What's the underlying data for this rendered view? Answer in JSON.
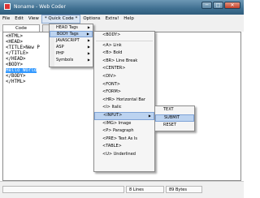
{
  "window": {
    "title": "Noname - Web Coder",
    "min": "─",
    "max": "□",
    "close": "✕"
  },
  "menubar": [
    "File",
    "Edit",
    "View",
    "* Quick Code *",
    "Options",
    "Extra!",
    "Help"
  ],
  "tabs": [
    "Code",
    ""
  ],
  "code_lines": [
    "<HTML>",
    "<HEAD>",
    "<TITLE>New P",
    "</TITLE>",
    "</HEAD>",
    "<BODY>",
    "Hello World",
    "</BODY>",
    "</HTML>"
  ],
  "quick_code_menu": [
    "HEAD Tags",
    "BODY Tags",
    "JAVASCRIPT",
    "ASP",
    "PHP",
    "Symbols"
  ],
  "body_tags_menu": [
    "<BODY>",
    "<A> Link",
    "<B> Bold",
    "<BR> Line Break",
    "<CENTER>",
    "<DIV>",
    "<FONT>",
    "<FORM>",
    "<HR> Horizontal Bar",
    "<I> Italic",
    "<INPUT>",
    "<IMG> Image",
    "<P> Paragraph",
    "<PRE> Text As Is",
    "<TABLE>",
    "<U> Underlined"
  ],
  "input_menu": [
    "TEXT",
    "SUBMIT",
    "RESET"
  ],
  "status": {
    "lines": "8 Lines",
    "bytes": "89 Bytes"
  }
}
